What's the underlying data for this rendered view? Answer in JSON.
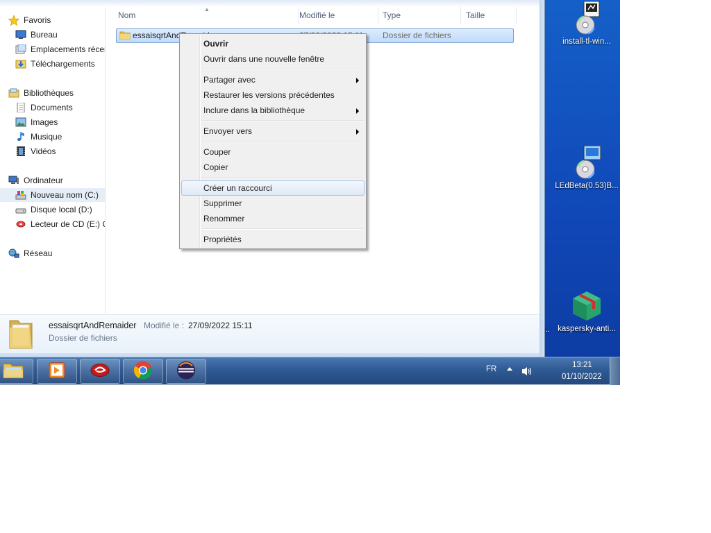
{
  "explorer": {
    "nav": {
      "favorites_header": "Favoris",
      "favorites": [
        "Bureau",
        "Emplacements récer",
        "Téléchargements"
      ],
      "libraries_header": "Bibliothèques",
      "libraries": [
        "Documents",
        "Images",
        "Musique",
        "Vidéos"
      ],
      "computer_header": "Ordinateur",
      "drives": [
        "Nouveau nom (C:)",
        "Disque local (D:)",
        "Lecteur de CD (E:) C"
      ],
      "network": "Réseau"
    },
    "columns": {
      "name": "Nom",
      "modified": "Modifié le",
      "type": "Type",
      "size": "Taille"
    },
    "row": {
      "name": "essaisqrtAndRemaider",
      "date": "27/09/2022 15:11",
      "type": "Dossier de fichiers"
    },
    "details": {
      "name": "essaisqrtAndRemaider",
      "modified_label": "Modifié le :",
      "modified_value": "27/09/2022 15:11",
      "type": "Dossier de fichiers"
    }
  },
  "context_menu": {
    "items": [
      {
        "label": "Ouvrir",
        "bold": true
      },
      {
        "label": "Ouvrir dans une nouvelle fenêtre"
      },
      {
        "label": "Partager avec",
        "submenu": true
      },
      {
        "label": "Restaurer les versions précédentes"
      },
      {
        "label": "Inclure dans la bibliothèque",
        "submenu": true
      },
      {
        "label": "Envoyer vers",
        "submenu": true
      },
      {
        "label": "Couper"
      },
      {
        "label": "Copier"
      },
      {
        "label": "Créer un raccourci",
        "highlighted": true
      },
      {
        "label": "Supprimer"
      },
      {
        "label": "Renommer"
      },
      {
        "label": "Propriétés"
      }
    ]
  },
  "desktop": {
    "icons": [
      "install-tl-win...",
      "LEdBeta(0.53)B...",
      "kaspersky-anti..."
    ],
    "partial_label": "i..."
  },
  "taskbar": {
    "apps": [
      "folder-icon",
      "media-player-icon",
      "red-app-icon",
      "chrome-icon",
      "eclipse-icon"
    ],
    "language": "FR",
    "time": "13:21",
    "date": "01/10/2022"
  },
  "colors": {
    "desktop": "#1560c8",
    "taskbar": "#2f5a94",
    "selection": "#c1dbfc",
    "menu_bg": "#f0f0f0"
  }
}
